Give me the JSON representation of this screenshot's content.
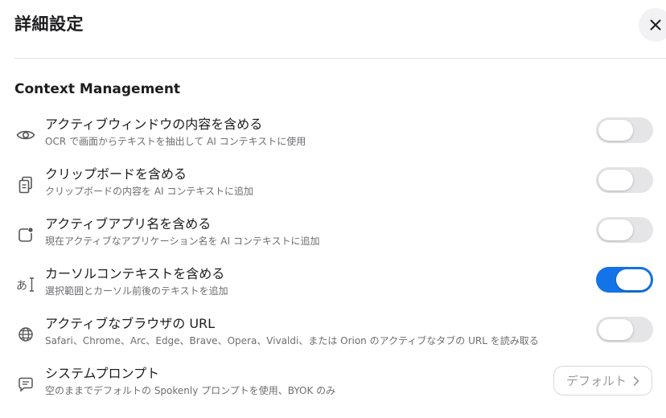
{
  "header": {
    "title": "詳細設定",
    "close_icon": "close-icon"
  },
  "section": {
    "title": "Context Management"
  },
  "rows": [
    {
      "icon": "eye-icon",
      "label": "アクティブウィンドウの内容を含める",
      "desc": "OCR で画面からテキストを抽出して AI コンテキストに使用",
      "toggle_on": false
    },
    {
      "icon": "clipboard-icon",
      "label": "クリップボードを含める",
      "desc": "クリップボードの内容を AI コンテキストに追加",
      "toggle_on": false
    },
    {
      "icon": "app-window-icon",
      "label": "アクティブアプリ名を含める",
      "desc": "現在アクティブなアプリケーション名を AI コンテキストに追加",
      "toggle_on": false
    },
    {
      "icon": "text-cursor-icon",
      "label": "カーソルコンテキストを含める",
      "desc": "選択範囲とカーソル前後のテキストを追加",
      "toggle_on": true
    },
    {
      "icon": "globe-icon",
      "label": "アクティブなブラウザの URL",
      "desc": "Safari、Chrome、Arc、Edge、Brave、Opera、Vivaldi、または Orion のアクティブなタブの URL を読み取る",
      "toggle_on": false
    },
    {
      "icon": "message-icon",
      "label": "システムプロンプト",
      "desc": "空のままでデフォルトの Spokenly プロンプトを使用、BYOK のみ"
    }
  ],
  "system_prompt_button": {
    "label": "デフォルト",
    "icon": "chevron-right-icon"
  },
  "colors": {
    "toggle_on": "#1473e6",
    "toggle_off": "#e5e5e7"
  }
}
